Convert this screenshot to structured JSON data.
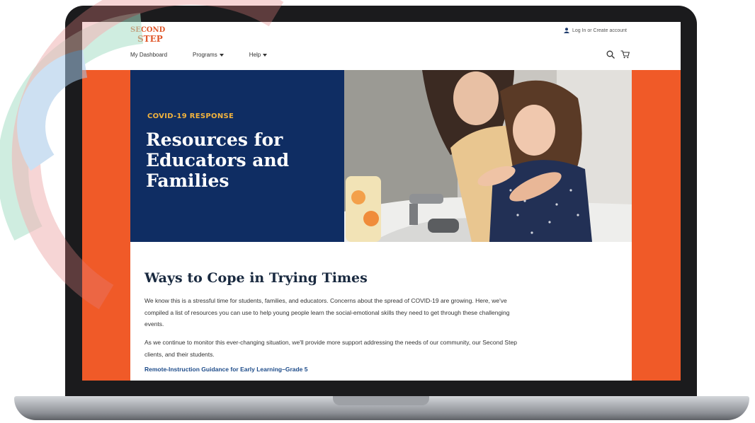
{
  "header": {
    "logo_line1": "SECOND",
    "logo_line2": "STEP",
    "account_link": "Log In or Create account",
    "nav": [
      {
        "label": "My Dashboard"
      },
      {
        "label": "Programs"
      },
      {
        "label": "Help"
      }
    ]
  },
  "hero": {
    "eyebrow": "COVID-19 RESPONSE",
    "title": "Resources for Educators and Families"
  },
  "content": {
    "heading": "Ways to Cope in Trying Times",
    "paragraph1": "We know this is a stressful time for students, families, and educators. Concerns about the spread of COVID-19 are growing. Here, we've compiled a list of resources you can use to help young people learn the social-emotional skills they need to get through these challenging events.",
    "paragraph2": "As we continue to monitor this ever-changing situation, we'll provide more support addressing the needs of our community, our Second Step clients, and their students.",
    "link": "Remote-Instruction Guidance for Early Learning–Grade 5"
  },
  "colors": {
    "brand_orange": "#f05a28",
    "hero_navy": "#0f2d63",
    "eyebrow_gold": "#f2b33d",
    "link_blue": "#1e4c8a"
  },
  "icons": [
    "user-icon",
    "search-icon",
    "cart-icon"
  ]
}
